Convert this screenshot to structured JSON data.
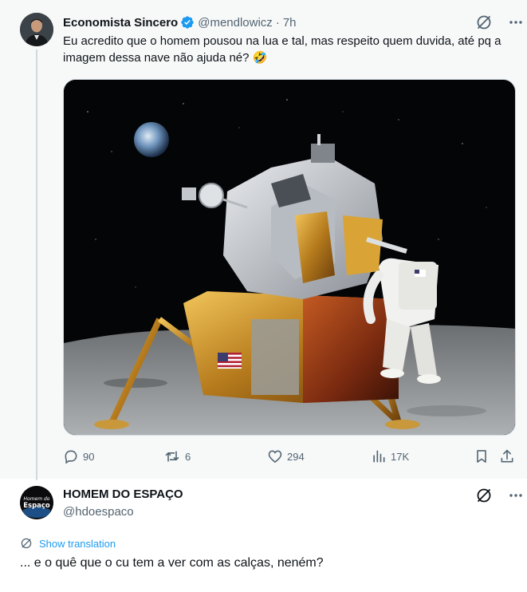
{
  "tweet": {
    "display_name": "Economista Sincero",
    "handle": "@mendlowicz",
    "separator": "·",
    "time": "7h",
    "text": "Eu acredito que o homem pousou na lua e tal, mas respeito quem duvida, até pq a imagem dessa nave não ajuda né? 🤣",
    "stats": {
      "replies": "90",
      "retweets": "6",
      "likes": "294",
      "views": "17K"
    }
  },
  "reply": {
    "display_name": "HOMEM DO ESPAÇO",
    "handle": "@hdoespaco",
    "avatar_text_top": "Homem do",
    "avatar_text_bottom": "Espaço",
    "show_translation": "Show translation",
    "text": "... e o quê que o cu tem a ver com as calças, neném?"
  },
  "colors": {
    "accent": "#1d9bf0",
    "muted": "#536471",
    "text": "#0f1419"
  },
  "icons": [
    "grok-icon",
    "more-icon",
    "reply-icon",
    "retweet-icon",
    "like-icon",
    "views-icon",
    "bookmark-icon",
    "share-icon",
    "verified-icon",
    "translate-icon"
  ]
}
